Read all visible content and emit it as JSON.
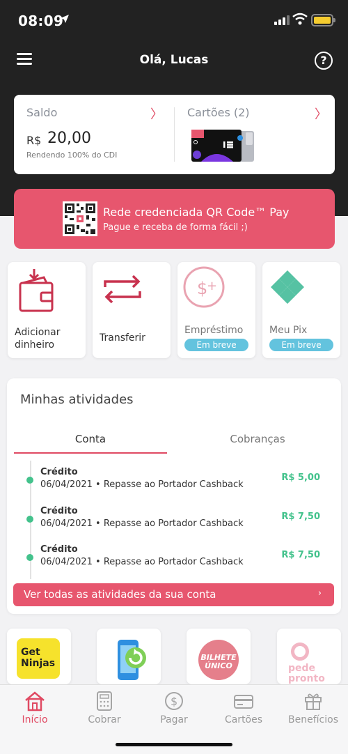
{
  "status_bar": {
    "time": "08:09"
  },
  "header": {
    "greeting": "Olá, Lucas",
    "help_label": "?"
  },
  "balance": {
    "label": "Saldo",
    "currency": "R$",
    "value": "20,00",
    "subtitle": "Rendendo 100% do CDI",
    "chevron": "〉"
  },
  "cards": {
    "label": "Cartões (2)",
    "chevron": "〉"
  },
  "qr_banner": {
    "title": "Rede credenciada QR Code™ Pay",
    "subtitle": "Pague e receba de forma fácil ;)"
  },
  "actions": [
    {
      "label": "Adicionar\ndinheiro",
      "icon": "wallet-icon"
    },
    {
      "label": "Transferir",
      "icon": "transfer-arrows-icon"
    },
    {
      "label": "Empréstimo",
      "icon": "loan-icon",
      "badge": "Em breve"
    },
    {
      "label": "Meu Pix",
      "icon": "pix-icon",
      "badge": "Em breve"
    }
  ],
  "activities": {
    "title": "Minhas atividades",
    "tabs": [
      {
        "label": "Conta",
        "active": true
      },
      {
        "label": "Cobranças",
        "active": false
      }
    ],
    "items": [
      {
        "type": "Crédito",
        "description": "06/04/2021 • Repasse ao Portador Cashback",
        "amount": "R$ 5,00"
      },
      {
        "type": "Crédito",
        "description": "06/04/2021 • Repasse ao Portador Cashback",
        "amount": "R$ 7,50"
      },
      {
        "type": "Crédito",
        "description": "06/04/2021 • Repasse ao Portador Cashback",
        "amount": "R$ 7,50"
      }
    ],
    "see_all": "Ver todas as atividades da sua conta",
    "see_all_chevron": "›"
  },
  "partners": [
    {
      "name": "Get Ninjas",
      "line1": "Get",
      "line2": "Ninjas"
    },
    {
      "name": "recharge",
      "icon": "phone-recharge-icon"
    },
    {
      "name": "Bilhete Único",
      "line1": "BILHETE",
      "line2": "ÚNICO"
    },
    {
      "name": "pede pronto",
      "line1": "pede",
      "line2": "pronto"
    }
  ],
  "bottom_nav": [
    {
      "label": "Início",
      "icon": "home-icon",
      "active": true
    },
    {
      "label": "Cobrar",
      "icon": "calculator-icon",
      "active": false
    },
    {
      "label": "Pagar",
      "icon": "dollar-circle-icon",
      "active": false
    },
    {
      "label": "Cartões",
      "icon": "card-icon",
      "active": false
    },
    {
      "label": "Benefícios",
      "icon": "gift-icon",
      "active": false
    }
  ],
  "colors": {
    "accent": "#e7566e",
    "dark": "#222222",
    "credit": "#43c28c",
    "soon_badge": "#63c3de"
  }
}
